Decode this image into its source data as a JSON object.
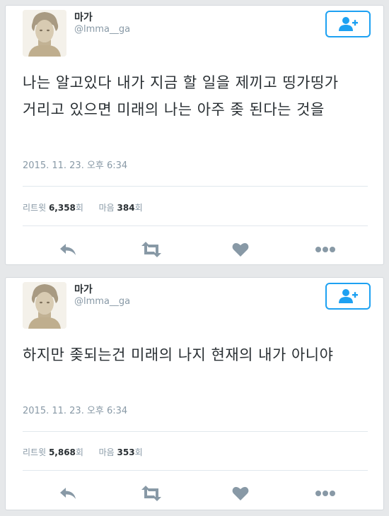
{
  "tweets": [
    {
      "user": {
        "name": "마가",
        "handle": "@lmma__ga"
      },
      "text": "나는 알고있다 내가 지금 할 일을 제끼고 띵가띵가 거리고 있으면 미래의 나는 아주 좆 된다는 것을",
      "timestamp": "2015. 11. 23. 오후 6:34",
      "stats": {
        "retweets_label": "리트윗",
        "retweets": "6,358",
        "retweets_unit": "회",
        "likes_label": "마음",
        "likes": "384",
        "likes_unit": "회"
      }
    },
    {
      "user": {
        "name": "마가",
        "handle": "@lmma__ga"
      },
      "text": "하지만 좆되는건 미래의 나지 현재의 내가 아니야",
      "timestamp": "2015. 11. 23. 오후 6:34",
      "stats": {
        "retweets_label": "리트윗",
        "retweets": "5,868",
        "retweets_unit": "회",
        "likes_label": "마음",
        "likes": "353",
        "likes_unit": "회"
      }
    }
  ],
  "icons": {
    "follow": "add-user-icon",
    "reply": "reply-icon",
    "retweet": "retweet-icon",
    "like": "heart-icon",
    "more": "more-icon"
  },
  "colors": {
    "accent": "#1da1f2",
    "action_icon": "#8899a6",
    "text": "#292f33",
    "muted": "#8899a6"
  }
}
